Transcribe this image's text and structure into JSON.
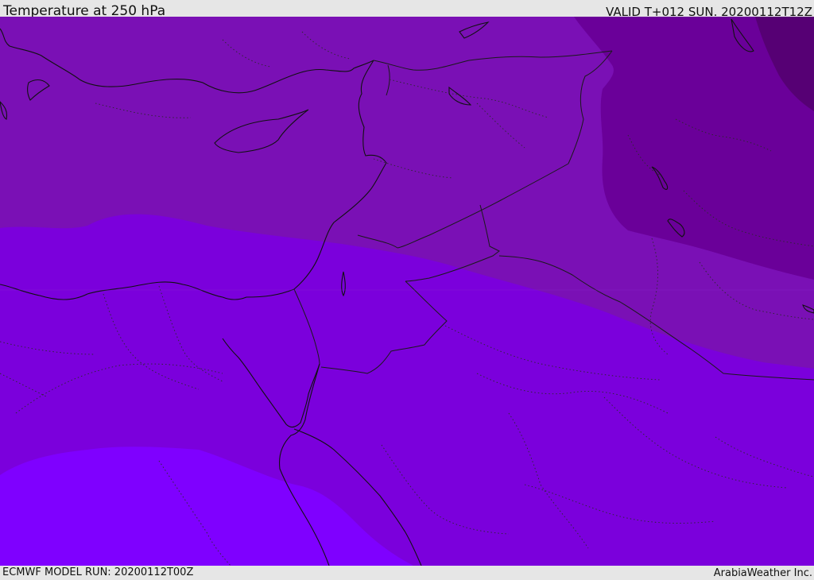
{
  "header": {
    "title": "Temperature at 250 hPa",
    "valid": "VALID T+012 SUN. 20200112T12Z"
  },
  "footer": {
    "model_run": "ECMWF MODEL RUN: 20200112T00Z",
    "credit": "ArabiaWeather Inc."
  },
  "map": {
    "field": "temperature",
    "level": "250 hPa",
    "region": "Eastern Mediterranean / Middle East",
    "colors": {
      "coldest": "#560074",
      "colder": "#6a0099",
      "cold": "#7a10b5",
      "mid": "#7b00dc",
      "warm": "#7f00ff",
      "coast": "#111111",
      "border": "#222222"
    }
  }
}
